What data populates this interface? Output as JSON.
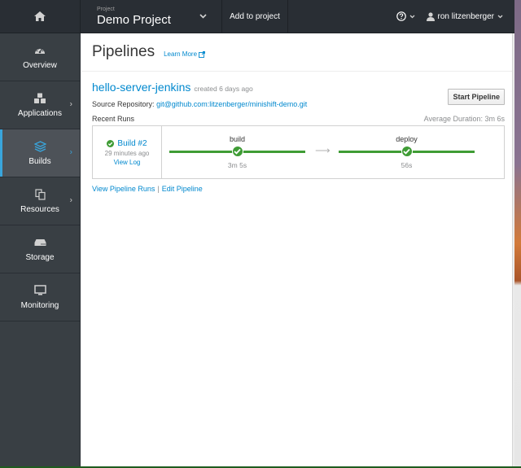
{
  "topnav": {
    "home_icon": "home-icon",
    "project_label": "Project",
    "project_name": "Demo Project",
    "add_to_project": "Add to project",
    "help_icon": "help-icon",
    "user_icon": "user-icon",
    "user_name": "ron litzenberger"
  },
  "sidebar": {
    "items": [
      {
        "label": "Overview",
        "icon": "dashboard-icon",
        "has_submenu": false,
        "active": false
      },
      {
        "label": "Applications",
        "icon": "cubes-icon",
        "has_submenu": true,
        "active": false
      },
      {
        "label": "Builds",
        "icon": "layers-icon",
        "has_submenu": true,
        "active": true
      },
      {
        "label": "Resources",
        "icon": "files-icon",
        "has_submenu": true,
        "active": false
      },
      {
        "label": "Storage",
        "icon": "storage-icon",
        "has_submenu": false,
        "active": false
      },
      {
        "label": "Monitoring",
        "icon": "monitor-icon",
        "has_submenu": false,
        "active": false
      }
    ]
  },
  "page": {
    "title": "Pipelines",
    "learn_more": "Learn More",
    "learn_more_icon": "external-link-icon"
  },
  "pipeline": {
    "name": "hello-server-jenkins",
    "created": "created 6 days ago",
    "start_button": "Start Pipeline",
    "source_label": "Source Repository:",
    "source_url": "git@github.com:litzenberger/minishift-demo.git",
    "recent_runs_label": "Recent Runs",
    "average_duration": "Average Duration: 3m 6s",
    "run": {
      "status": "success",
      "status_color": "#3f9c35",
      "build_label": "Build #2",
      "ago": "29 minutes ago",
      "view_log": "View Log",
      "stages": [
        {
          "name": "build",
          "duration": "3m 5s",
          "status": "success"
        },
        {
          "name": "deploy",
          "duration": "56s",
          "status": "success"
        }
      ]
    },
    "view_runs": "View Pipeline Runs",
    "separator": "|",
    "edit": "Edit Pipeline"
  },
  "colors": {
    "accent": "#0088ce",
    "nav_bg": "#292e34",
    "sidebar_bg": "#393f44",
    "active_indicator": "#39a5dc",
    "success": "#3f9c35"
  }
}
